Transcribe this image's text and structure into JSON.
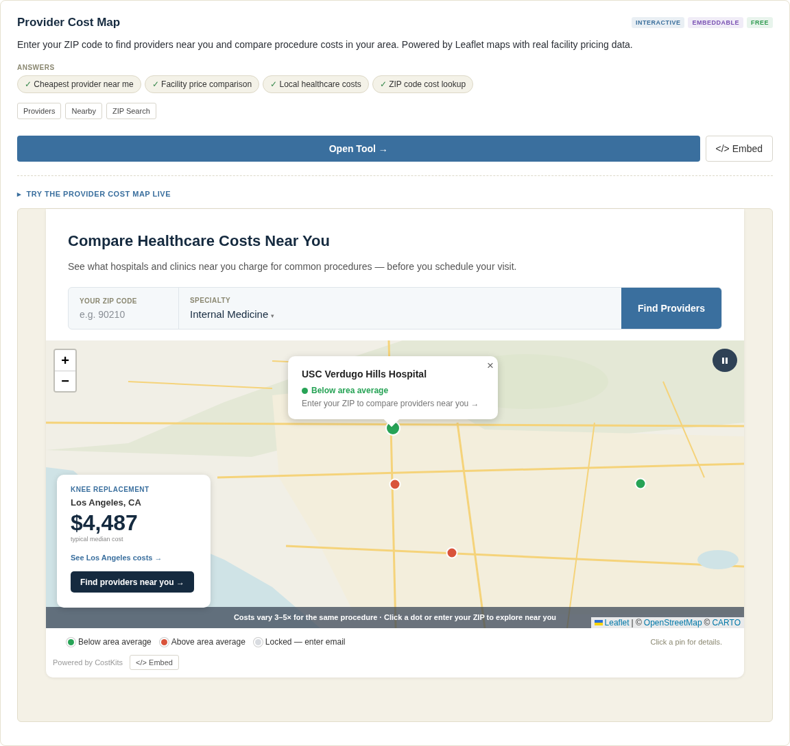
{
  "header": {
    "title": "Provider Cost Map",
    "badges": [
      {
        "label": "INTERACTIVE",
        "color": "#3a6f9c"
      },
      {
        "label": "EMBEDDABLE",
        "color": "#7a52b3"
      },
      {
        "label": "FREE",
        "color": "#2f9a4f"
      }
    ]
  },
  "description": "Enter your ZIP code to find providers near you and compare procedure costs in your area. Powered by Leaflet maps with real facility pricing data.",
  "answers": {
    "label": "ANSWERS",
    "check": "✓",
    "items": [
      "Cheapest provider near me",
      "Facility price comparison",
      "Local healthcare costs",
      "ZIP code cost lookup"
    ]
  },
  "tags": [
    "Providers",
    "Nearby",
    "ZIP Search"
  ],
  "actions": {
    "open": "Open Tool →",
    "embed": "</> Embed"
  },
  "try_toggle": {
    "arrow": "▸",
    "label": "TRY THE PROVIDER COST MAP LIVE"
  },
  "widget": {
    "title": "Compare Healthcare Costs Near You",
    "subtitle": "See what hospitals and clinics near you charge for common procedures — before you schedule your visit.",
    "zip": {
      "label": "YOUR ZIP CODE",
      "placeholder": "e.g. 90210"
    },
    "specialty": {
      "label": "SPECIALTY",
      "value": "Internal Medicine",
      "caret": "▾"
    },
    "find_button": "Find Providers",
    "map": {
      "kind": "picture",
      "zoom_in": "+",
      "zoom_out": "−",
      "markers": [
        {
          "color": "#27a356"
        },
        {
          "color": "#d9533b"
        },
        {
          "color": "#27a356"
        },
        {
          "color": "#d9533b"
        }
      ],
      "popup": {
        "title": "USC Verdugo Hills Hospital",
        "status": "Below area average",
        "hint": "Enter your ZIP to compare providers near you →",
        "close": "×"
      },
      "cost_card": {
        "procedure": "KNEE REPLACEMENT",
        "location": "Los Angeles, CA",
        "price": "$4,487",
        "price_note": "typical median cost",
        "link": "See Los Angeles costs →",
        "button": "Find providers near you →"
      },
      "banner": "Costs vary 3–5× for the same procedure · Click a dot or enter your ZIP to explore near you",
      "attribution": {
        "leaflet": "Leaflet",
        "sep1": "| ©",
        "osm": "OpenStreetMap",
        "sep2": "©",
        "carto": "CARTO"
      }
    },
    "legend": [
      {
        "label": "Below area average",
        "color": "#27a356"
      },
      {
        "label": "Above area average",
        "color": "#d9533b"
      },
      {
        "label": "Locked — enter email",
        "color": "#d8dbe0"
      }
    ],
    "legend_hint": "Click a pin for details.",
    "powered_by": "Powered by CostKits",
    "embed": "</> Embed"
  }
}
